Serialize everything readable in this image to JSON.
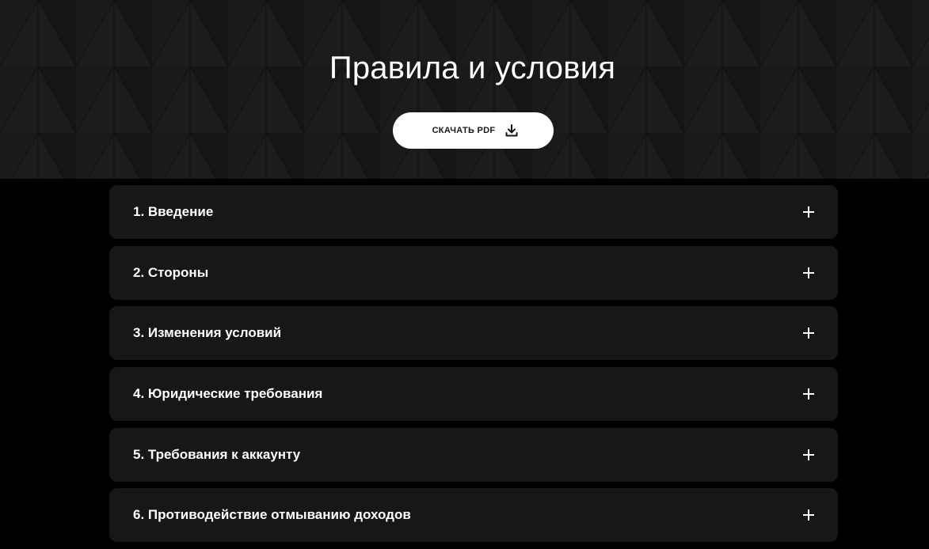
{
  "hero": {
    "title": "Правила и условия",
    "download_button_label": "СКАЧАТЬ PDF",
    "download_icon": "download-icon"
  },
  "accordion": {
    "items": [
      {
        "title": "1. Введение",
        "expanded": false,
        "icon": "plus-icon"
      },
      {
        "title": "2. Стороны",
        "expanded": false,
        "icon": "plus-icon"
      },
      {
        "title": "3. Изменения условий",
        "expanded": false,
        "icon": "plus-icon"
      },
      {
        "title": "4. Юридические требования",
        "expanded": false,
        "icon": "plus-icon"
      },
      {
        "title": "5. Требования к аккаунту",
        "expanded": false,
        "icon": "plus-icon"
      },
      {
        "title": "6. Противодействие отмыванию доходов",
        "expanded": false,
        "icon": "plus-icon"
      }
    ]
  },
  "colors": {
    "page_background": "#000000",
    "hero_background": "#1c1c1f",
    "card_background": "#17171a",
    "text": "#ffffff",
    "button_background": "#ffffff",
    "button_text": "#161616"
  }
}
